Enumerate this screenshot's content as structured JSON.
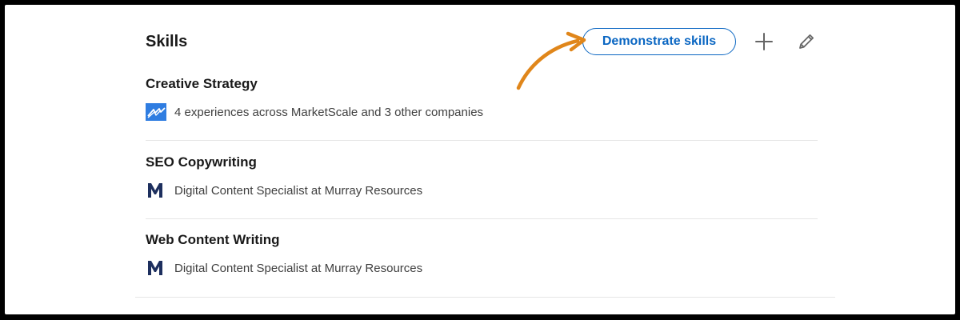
{
  "section": {
    "title": "Skills"
  },
  "actions": {
    "demonstrate_label": "Demonstrate skills",
    "add_icon": "plus-icon",
    "edit_icon": "pencil-icon"
  },
  "skills": [
    {
      "name": "Creative Strategy",
      "detail": "4 experiences across MarketScale and 3 other companies",
      "logo": "marketscale-logo"
    },
    {
      "name": "SEO Copywriting",
      "detail": "Digital Content Specialist at Murray Resources",
      "logo": "murray-resources-logo"
    },
    {
      "name": "Web Content Writing",
      "detail": "Digital Content Specialist at Murray Resources",
      "logo": "murray-resources-logo"
    }
  ],
  "colors": {
    "accent": "#0a66c2",
    "annotation_arrow": "#e0861a",
    "marketscale_logo": "#2f7de1",
    "murray_logo": "#1d2f5e",
    "text_primary": "#191919",
    "text_secondary": "#404040",
    "divider": "#e6e6e6"
  }
}
